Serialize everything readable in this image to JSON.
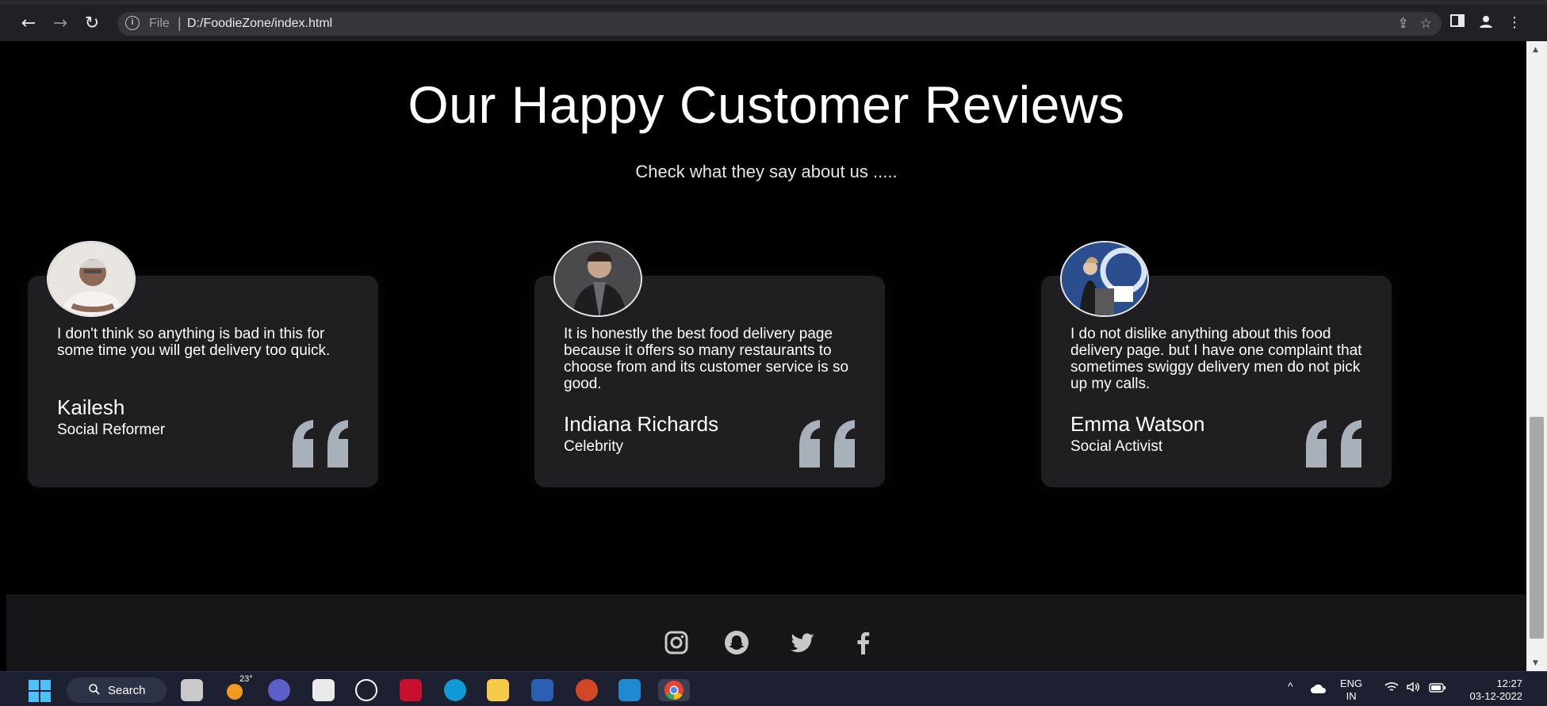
{
  "browser": {
    "url_scheme": "File",
    "url_separator": "|",
    "url_path": "D:/FoodieZone/index.html",
    "icons": {
      "back": "arrow-left-icon",
      "forward": "arrow-right-icon",
      "reload": "reload-icon",
      "info": "info-icon",
      "share": "share-icon",
      "bookmark": "star-icon",
      "side_panel": "side-panel-icon",
      "profile": "profile-icon",
      "menu": "kebab-menu-icon"
    }
  },
  "reviews": {
    "title": "Our Happy Customer Reviews",
    "subtitle": "Check what they say about us .....",
    "cards": [
      {
        "text": "I don't think so anything is bad in this for some time you will get delivery too quick.",
        "name": "Kailesh",
        "role": "Social Reformer"
      },
      {
        "text": "It is honestly the best food delivery page because it offers so many restaurants to choose from and its customer service is so good.",
        "name": "Indiana Richards",
        "role": "Celebrity"
      },
      {
        "text": "I do not dislike anything about this food delivery page. but I have one complaint that sometimes swiggy delivery men do not pick up my calls.",
        "name": "Emma Watson",
        "role": "Social Activist"
      }
    ]
  },
  "footer": {
    "social_icons": [
      "instagram-icon",
      "snapchat-icon",
      "twitter-icon",
      "facebook-icon"
    ]
  },
  "taskbar": {
    "search_label": "Search",
    "weather_temp": "23°",
    "language": "ENG",
    "region": "IN",
    "time": "12:27",
    "date": "03-12-2022"
  },
  "colors": {
    "page_bg": "#000000",
    "card_bg": "#1f1f21",
    "quote_color": "#a8b0ba",
    "footer_bg": "#161618"
  }
}
